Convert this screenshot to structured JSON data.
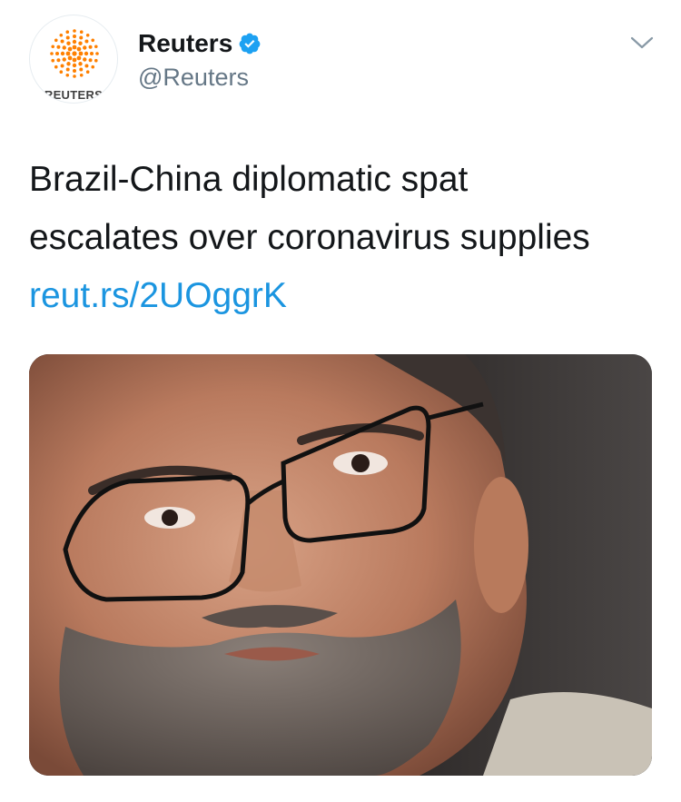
{
  "header": {
    "display_name": "Reuters",
    "handle": "@Reuters",
    "verified": true,
    "avatar_label": "REUTERS",
    "brand_color": "#ff8000"
  },
  "tweet": {
    "text_lines": [
      "Brazil-China diplomatic spat",
      "escalates over coronavirus supplies"
    ],
    "link_text": "reut.rs/2UOggrK",
    "link_color": "#1b95e0"
  },
  "media": {
    "icon": "photo-of-man-with-glasses"
  },
  "icons": {
    "verified": "verified-badge-icon",
    "menu": "chevron-down-icon"
  }
}
